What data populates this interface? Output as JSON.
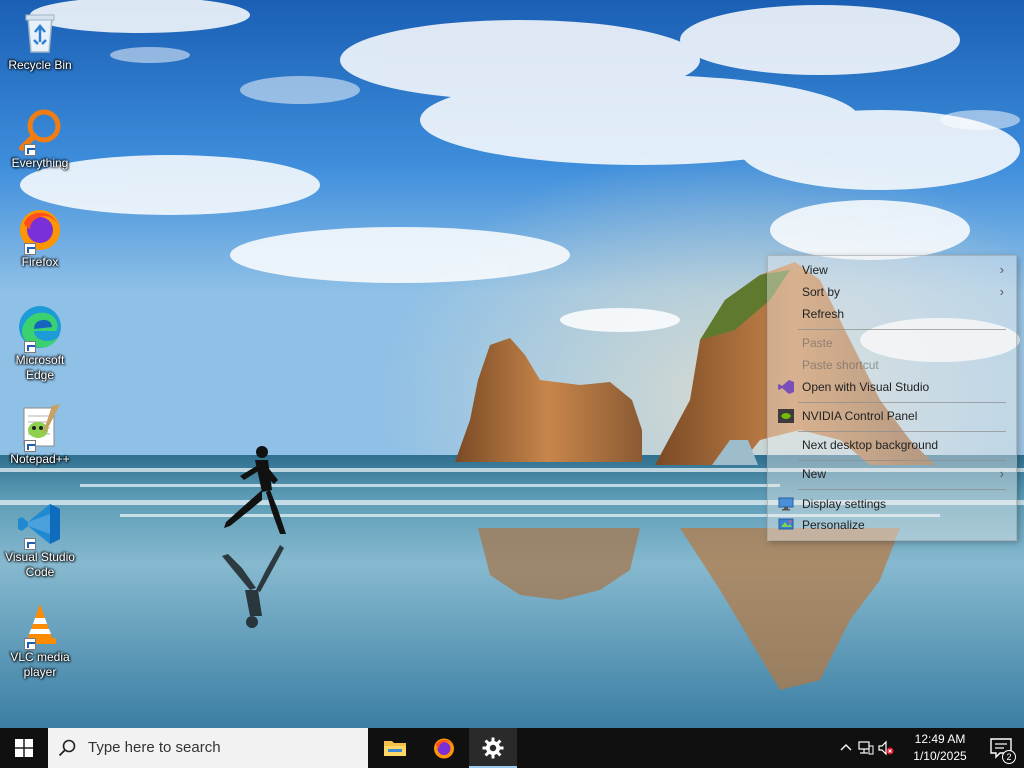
{
  "desktop": {
    "icons": [
      {
        "label": "Recycle Bin",
        "icon": "recycle-bin-icon"
      },
      {
        "label": "Everything",
        "icon": "everything-search-icon"
      },
      {
        "label": "Firefox",
        "icon": "firefox-icon"
      },
      {
        "label": "Microsoft Edge",
        "icon": "edge-icon"
      },
      {
        "label": "Notepad++",
        "icon": "notepad-plus-plus-icon"
      },
      {
        "label": "Visual Studio Code",
        "icon": "vscode-icon"
      },
      {
        "label": "VLC media player",
        "icon": "vlc-icon"
      }
    ]
  },
  "context_menu": {
    "items": [
      {
        "label": "View",
        "submenu": true,
        "disabled": false
      },
      {
        "label": "Sort by",
        "submenu": true,
        "disabled": false
      },
      {
        "label": "Refresh",
        "submenu": false,
        "disabled": false
      },
      {
        "label": "Paste",
        "submenu": false,
        "disabled": true
      },
      {
        "label": "Paste shortcut",
        "submenu": false,
        "disabled": true
      },
      {
        "label": "Open with Visual Studio",
        "submenu": false,
        "disabled": false,
        "icon": "visual-studio-icon"
      },
      {
        "label": "NVIDIA Control Panel",
        "submenu": false,
        "disabled": false,
        "icon": "nvidia-icon"
      },
      {
        "label": "Next desktop background",
        "submenu": false,
        "disabled": false
      },
      {
        "label": "New",
        "submenu": true,
        "disabled": false
      },
      {
        "label": "Display settings",
        "submenu": false,
        "disabled": false,
        "icon": "display-icon"
      },
      {
        "label": "Personalize",
        "submenu": false,
        "disabled": false,
        "icon": "personalize-icon"
      }
    ]
  },
  "taskbar": {
    "search_placeholder": "Type here to search",
    "apps": [
      {
        "name": "File Explorer",
        "icon": "file-explorer-icon",
        "running": false
      },
      {
        "name": "Firefox",
        "icon": "firefox-icon",
        "running": false
      },
      {
        "name": "Settings",
        "icon": "settings-gear-icon",
        "running": true
      }
    ],
    "clock": {
      "time": "12:49 AM",
      "date": "1/10/2025"
    },
    "notification_count": "2"
  },
  "colors": {
    "taskbar_bg": "#101010",
    "accent": "#0078d7",
    "sky_top": "#1f6fc4",
    "sea": "#3f86a8"
  }
}
